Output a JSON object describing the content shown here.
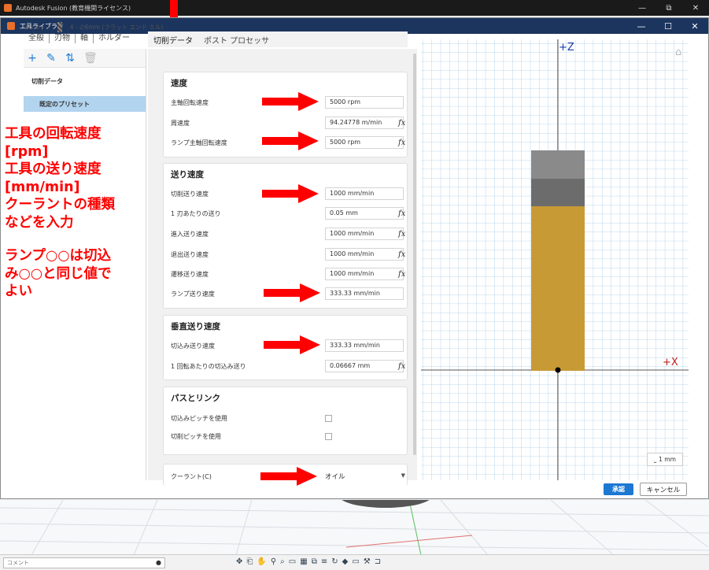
{
  "app": {
    "title": "Autodesk Fusion (教育機関ライセンス)",
    "win_min": "—",
    "win_max": "⧉",
    "win_close": "✕"
  },
  "dialog": {
    "title": "工具ライブラリ",
    "win_min": "—",
    "win_max": "☐",
    "win_close": "✕"
  },
  "breadcrumb": {
    "library": "Library",
    "sep": "/",
    "tool": "4 - ∅6mm (フラット エンド ミル)"
  },
  "tabs_left": [
    "全般",
    "刃物",
    "軸",
    "ホルダー"
  ],
  "tabs_right": [
    "切削データ",
    "ポスト プロセッサ"
  ],
  "left_toolbar": {
    "add": "+",
    "edit": "✎",
    "sort": "⇅",
    "delete": "🗑"
  },
  "left_panel": {
    "heading": "切削データ",
    "preset": "既定のプリセット"
  },
  "annotation": {
    "lines": [
      "工具の回転速度",
      "[rpm]",
      "工具の送り速度",
      "[mm/min]",
      "クーラントの種類",
      "などを入力",
      "ランプ○○は切込",
      "み○○と同じ値で",
      "よい"
    ]
  },
  "sections": {
    "speed": {
      "title": "速度",
      "spindle_label": "主軸回転速度",
      "spindle_value": "5000 rpm",
      "surface_label": "周速度",
      "surface_value": "94.24778 m/min",
      "ramp_spindle_label": "ランプ主軸回転速度",
      "ramp_spindle_value": "5000 rpm"
    },
    "feed": {
      "title": "送り速度",
      "cutting_label": "切削送り速度",
      "cutting_value": "1000 mm/min",
      "per_tooth_label": "1 刃あたりの送り",
      "per_tooth_value": "0.05 mm",
      "lead_in_label": "進入送り速度",
      "lead_in_value": "1000 mm/min",
      "lead_out_label": "退出送り速度",
      "lead_out_value": "1000 mm/min",
      "transition_label": "遷移送り速度",
      "transition_value": "1000 mm/min",
      "ramp_label": "ランプ送り速度",
      "ramp_value": "333.33 mm/min"
    },
    "vertical": {
      "title": "垂直送り速度",
      "plunge_label": "切込み送り速度",
      "plunge_value": "333.33 mm/min",
      "per_rev_label": "1 回転あたりの切込み送り",
      "per_rev_value": "0.06667 mm"
    },
    "passes": {
      "title": "パスとリンク",
      "stepdown_label": "切込みピッチを使用",
      "stepover_label": "切削ピッチを使用"
    },
    "coolant": {
      "label": "クーラント(C)",
      "value": "オイル"
    }
  },
  "fx_label": "fx",
  "preview": {
    "z_label": "+Z",
    "x_label": "+X",
    "scale_label": "1 mm"
  },
  "buttons": {
    "accept": "承認",
    "cancel": "キャンセル"
  },
  "bottom": {
    "comment": "コメント",
    "comment_add": "●"
  },
  "colors": {
    "accent": "#1c78d2",
    "annotation": "#ff0000",
    "tool_body": "#c79a35",
    "tool_holder": "#7a7a7a"
  }
}
